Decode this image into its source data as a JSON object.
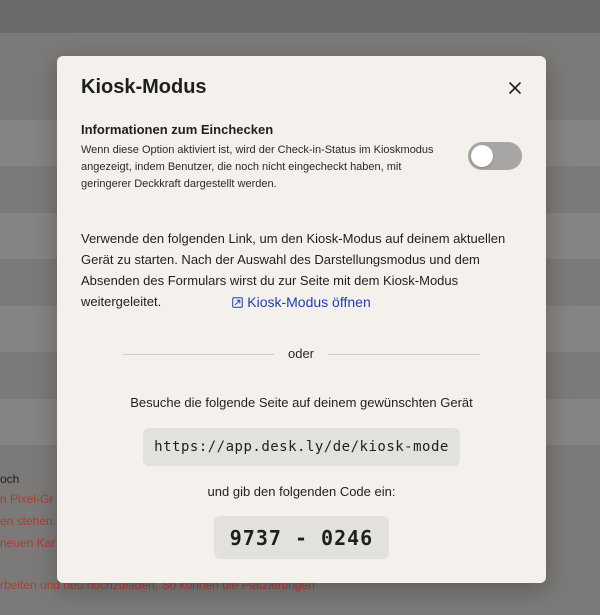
{
  "background": {
    "text_lines": [
      "och",
      "n Pixel-Gr",
      "en stehen.",
      "neuen Kar",
      "rbeiten und neu hochzuladen. So können die Platzierungen"
    ]
  },
  "modal": {
    "title": "Kiosk-Modus",
    "close_icon": "close-icon",
    "info": {
      "title": "Informationen zum Einchecken",
      "description": "Wenn diese Option aktiviert ist, wird der Check-in-Status im Kioskmodus angezeigt, indem Benutzer, die noch nicht eingecheckt haben, mit geringerer Deckkraft dargestellt werden.",
      "toggle_on": false
    },
    "link_description": "Verwende den folgenden Link, um den Kiosk-Modus auf deinem aktuellen Gerät zu starten. Nach der Auswahl des Darstellungsmodus und dem Absenden des Formulars wirst du zur Seite mit dem Kiosk-Modus weitergeleitet.",
    "open_link_label": "Kiosk-Modus öffnen",
    "open_link_icon": "external-link-icon",
    "divider_label": "oder",
    "visit_text": "Besuche die folgende Seite auf deinem gewünschten Gerät",
    "url": "https://app.desk.ly/de/kiosk-mode",
    "code_text": "und gib den folgenden Code ein:",
    "code": "9737 - 0246"
  },
  "colors": {
    "overlay": "#7b7a78",
    "modal_bg": "#f4f1ec",
    "link": "#1f3ea8",
    "toggle_off": "#a7a6a4",
    "code_box": "#e3e1de"
  }
}
